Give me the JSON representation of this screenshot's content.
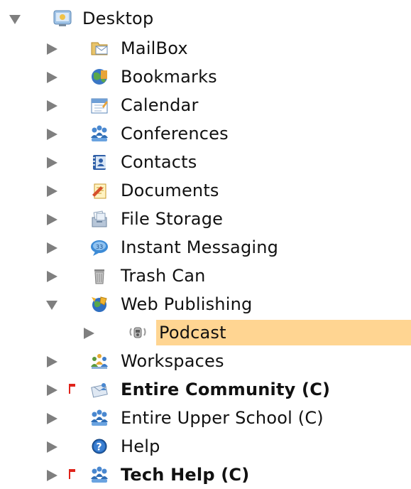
{
  "colors": {
    "selection": "#ffd592",
    "twisty": "#7f7f7f",
    "flag": "#e0241b"
  },
  "tree": {
    "root": {
      "label": "Desktop",
      "icon": "desktop-icon",
      "expanded": true
    },
    "items": [
      {
        "label": "MailBox",
        "icon": "mailbox-icon",
        "expanded": false
      },
      {
        "label": "Bookmarks",
        "icon": "bookmarks-globe-icon",
        "expanded": false
      },
      {
        "label": "Calendar",
        "icon": "calendar-icon",
        "expanded": false
      },
      {
        "label": "Conferences",
        "icon": "conferences-people-icon",
        "expanded": false
      },
      {
        "label": "Contacts",
        "icon": "contacts-icon",
        "expanded": false
      },
      {
        "label": "Documents",
        "icon": "documents-icon",
        "expanded": false
      },
      {
        "label": "File Storage",
        "icon": "file-storage-icon",
        "expanded": false
      },
      {
        "label": "Instant Messaging",
        "icon": "instant-messaging-icon",
        "expanded": false
      },
      {
        "label": "Trash Can",
        "icon": "trash-can-icon",
        "expanded": false
      },
      {
        "label": "Web Publishing",
        "icon": "web-publishing-icon",
        "expanded": true
      },
      {
        "label": "Podcast",
        "icon": "podcast-icon",
        "expanded": false,
        "selected": true
      },
      {
        "label": "Workspaces",
        "icon": "workspaces-icon",
        "expanded": false
      },
      {
        "label": "Entire Community (C)",
        "icon": "community-icon",
        "expanded": false,
        "flagged": true,
        "bold": true
      },
      {
        "label": "Entire Upper School (C)",
        "icon": "conferences-people-icon",
        "expanded": false
      },
      {
        "label": "Help",
        "icon": "help-icon",
        "expanded": false
      },
      {
        "label": "Tech Help (C)",
        "icon": "conferences-people-icon",
        "expanded": false,
        "flagged": true,
        "bold": true
      }
    ]
  }
}
